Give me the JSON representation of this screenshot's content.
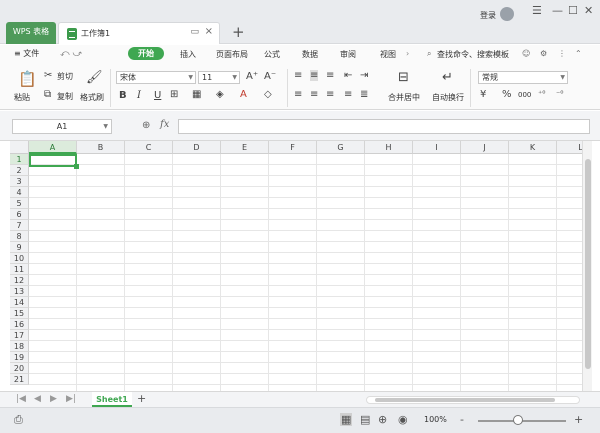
{
  "titlebar": {
    "app_tab": "WPS 表格",
    "doc_tab": "工作簿1",
    "login": "登录",
    "new_tab": "+",
    "win_controls": [
      "☰",
      "—",
      "☐",
      "✕"
    ]
  },
  "ribbon_tabs": {
    "menu": "≡ 文件",
    "tabs": [
      "开始",
      "插入",
      "页面布局",
      "公式",
      "数据",
      "审阅",
      "视图"
    ],
    "active": "开始",
    "search": "查找命令、搜索模板"
  },
  "ribbon": {
    "cut": "剪切",
    "copy": "复制",
    "paste": "粘贴",
    "format_painter": "格式刷",
    "font_name": "宋体",
    "font_size": "11",
    "bold": "B",
    "italic": "I",
    "underline": "U",
    "merge": "合并居中",
    "wrap": "自动换行",
    "number_format": "常规",
    "percent": "%",
    "thousands": "000"
  },
  "formula_bar": {
    "name_box": "A1",
    "fx": "fx",
    "value": ""
  },
  "grid": {
    "columns": [
      "A",
      "B",
      "C",
      "D",
      "E",
      "F",
      "G",
      "H",
      "I",
      "J",
      "K",
      "L"
    ],
    "rows": [
      "1",
      "2",
      "3",
      "4",
      "5",
      "6",
      "7",
      "8",
      "9",
      "10",
      "11",
      "12",
      "13",
      "14",
      "15",
      "16",
      "17",
      "18",
      "19",
      "20",
      "21"
    ],
    "selected_col": "A",
    "selected_row": "1"
  },
  "sheets": {
    "tabs": [
      "Sheet1"
    ],
    "active": "Sheet1",
    "add": "+"
  },
  "status": {
    "zoom": "100%",
    "zoom_minus": "-",
    "zoom_plus": "+",
    "zoom_level": 0.45
  },
  "colors": {
    "accent": "#3fa751",
    "app_tab": "#4e9a5a"
  }
}
